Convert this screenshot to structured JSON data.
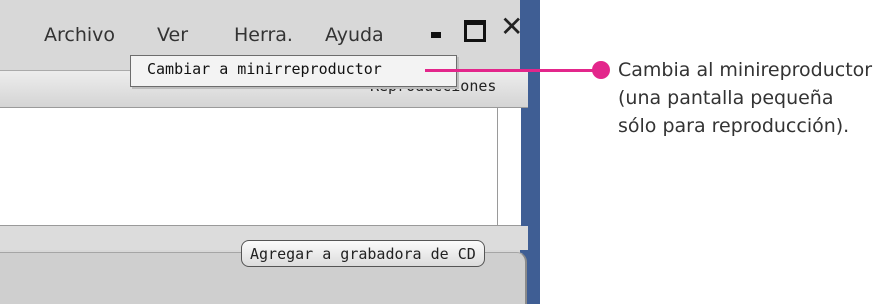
{
  "menu": {
    "items": [
      {
        "label": "Archivo"
      },
      {
        "label": "Ver"
      },
      {
        "label": "Herra."
      },
      {
        "label": "Ayuda"
      }
    ]
  },
  "window_controls": {
    "minimize_icon": "minimize-icon",
    "maximize_icon": "maximize-icon",
    "close_icon": "close-icon",
    "close_glyph": "✕"
  },
  "dropdown": {
    "item_label": "Cambiar a minirreproductor"
  },
  "list": {
    "header_text": "Reproducciones"
  },
  "buttons": {
    "add_to_cd": "Agregar a grabadora de CD"
  },
  "callout": {
    "lines": [
      "Cambia al minireproductor",
      "(una pantalla pequeña",
      "sólo para reproducción)."
    ],
    "accent_color": "#e3268b"
  }
}
